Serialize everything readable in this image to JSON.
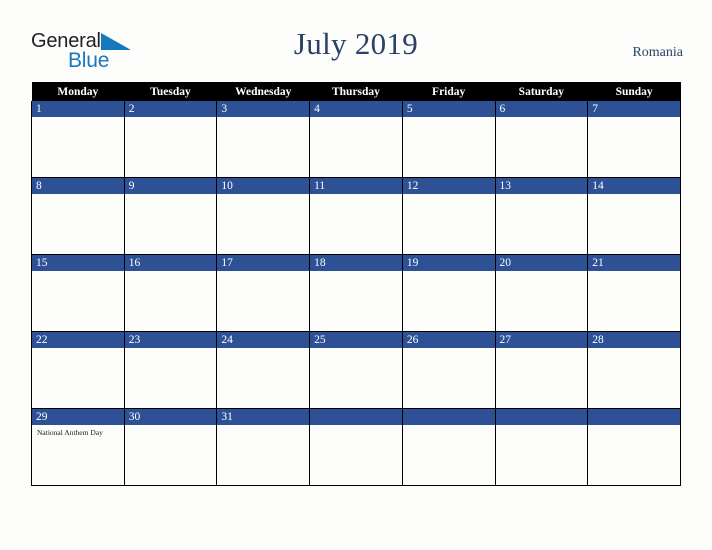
{
  "brand": {
    "name_part1": "General",
    "name_part2": "Blue",
    "triangle_color": "#1878be",
    "text_color": "#231f20"
  },
  "header": {
    "title": "July 2019",
    "country": "Romania",
    "title_color": "#2b4264"
  },
  "calendar": {
    "weekday_headers": [
      "Monday",
      "Tuesday",
      "Wednesday",
      "Thursday",
      "Friday",
      "Saturday",
      "Sunday"
    ],
    "header_bg": "#000000",
    "header_fg": "#ffffff",
    "daynum_bg": "#2e5196",
    "daynum_fg": "#ffffff",
    "cell_bg": "#fdfdfb",
    "grid_line": "#000000",
    "weeks": [
      [
        {
          "day": "1",
          "events": []
        },
        {
          "day": "2",
          "events": []
        },
        {
          "day": "3",
          "events": []
        },
        {
          "day": "4",
          "events": []
        },
        {
          "day": "5",
          "events": []
        },
        {
          "day": "6",
          "events": []
        },
        {
          "day": "7",
          "events": []
        }
      ],
      [
        {
          "day": "8",
          "events": []
        },
        {
          "day": "9",
          "events": []
        },
        {
          "day": "10",
          "events": []
        },
        {
          "day": "11",
          "events": []
        },
        {
          "day": "12",
          "events": []
        },
        {
          "day": "13",
          "events": []
        },
        {
          "day": "14",
          "events": []
        }
      ],
      [
        {
          "day": "15",
          "events": []
        },
        {
          "day": "16",
          "events": []
        },
        {
          "day": "17",
          "events": []
        },
        {
          "day": "18",
          "events": []
        },
        {
          "day": "19",
          "events": []
        },
        {
          "day": "20",
          "events": []
        },
        {
          "day": "21",
          "events": []
        }
      ],
      [
        {
          "day": "22",
          "events": []
        },
        {
          "day": "23",
          "events": []
        },
        {
          "day": "24",
          "events": []
        },
        {
          "day": "25",
          "events": []
        },
        {
          "day": "26",
          "events": []
        },
        {
          "day": "27",
          "events": []
        },
        {
          "day": "28",
          "events": []
        }
      ],
      [
        {
          "day": "29",
          "events": [
            "National Anthem Day"
          ]
        },
        {
          "day": "30",
          "events": []
        },
        {
          "day": "31",
          "events": []
        },
        {
          "day": "",
          "events": []
        },
        {
          "day": "",
          "events": []
        },
        {
          "day": "",
          "events": []
        },
        {
          "day": "",
          "events": []
        }
      ]
    ]
  }
}
